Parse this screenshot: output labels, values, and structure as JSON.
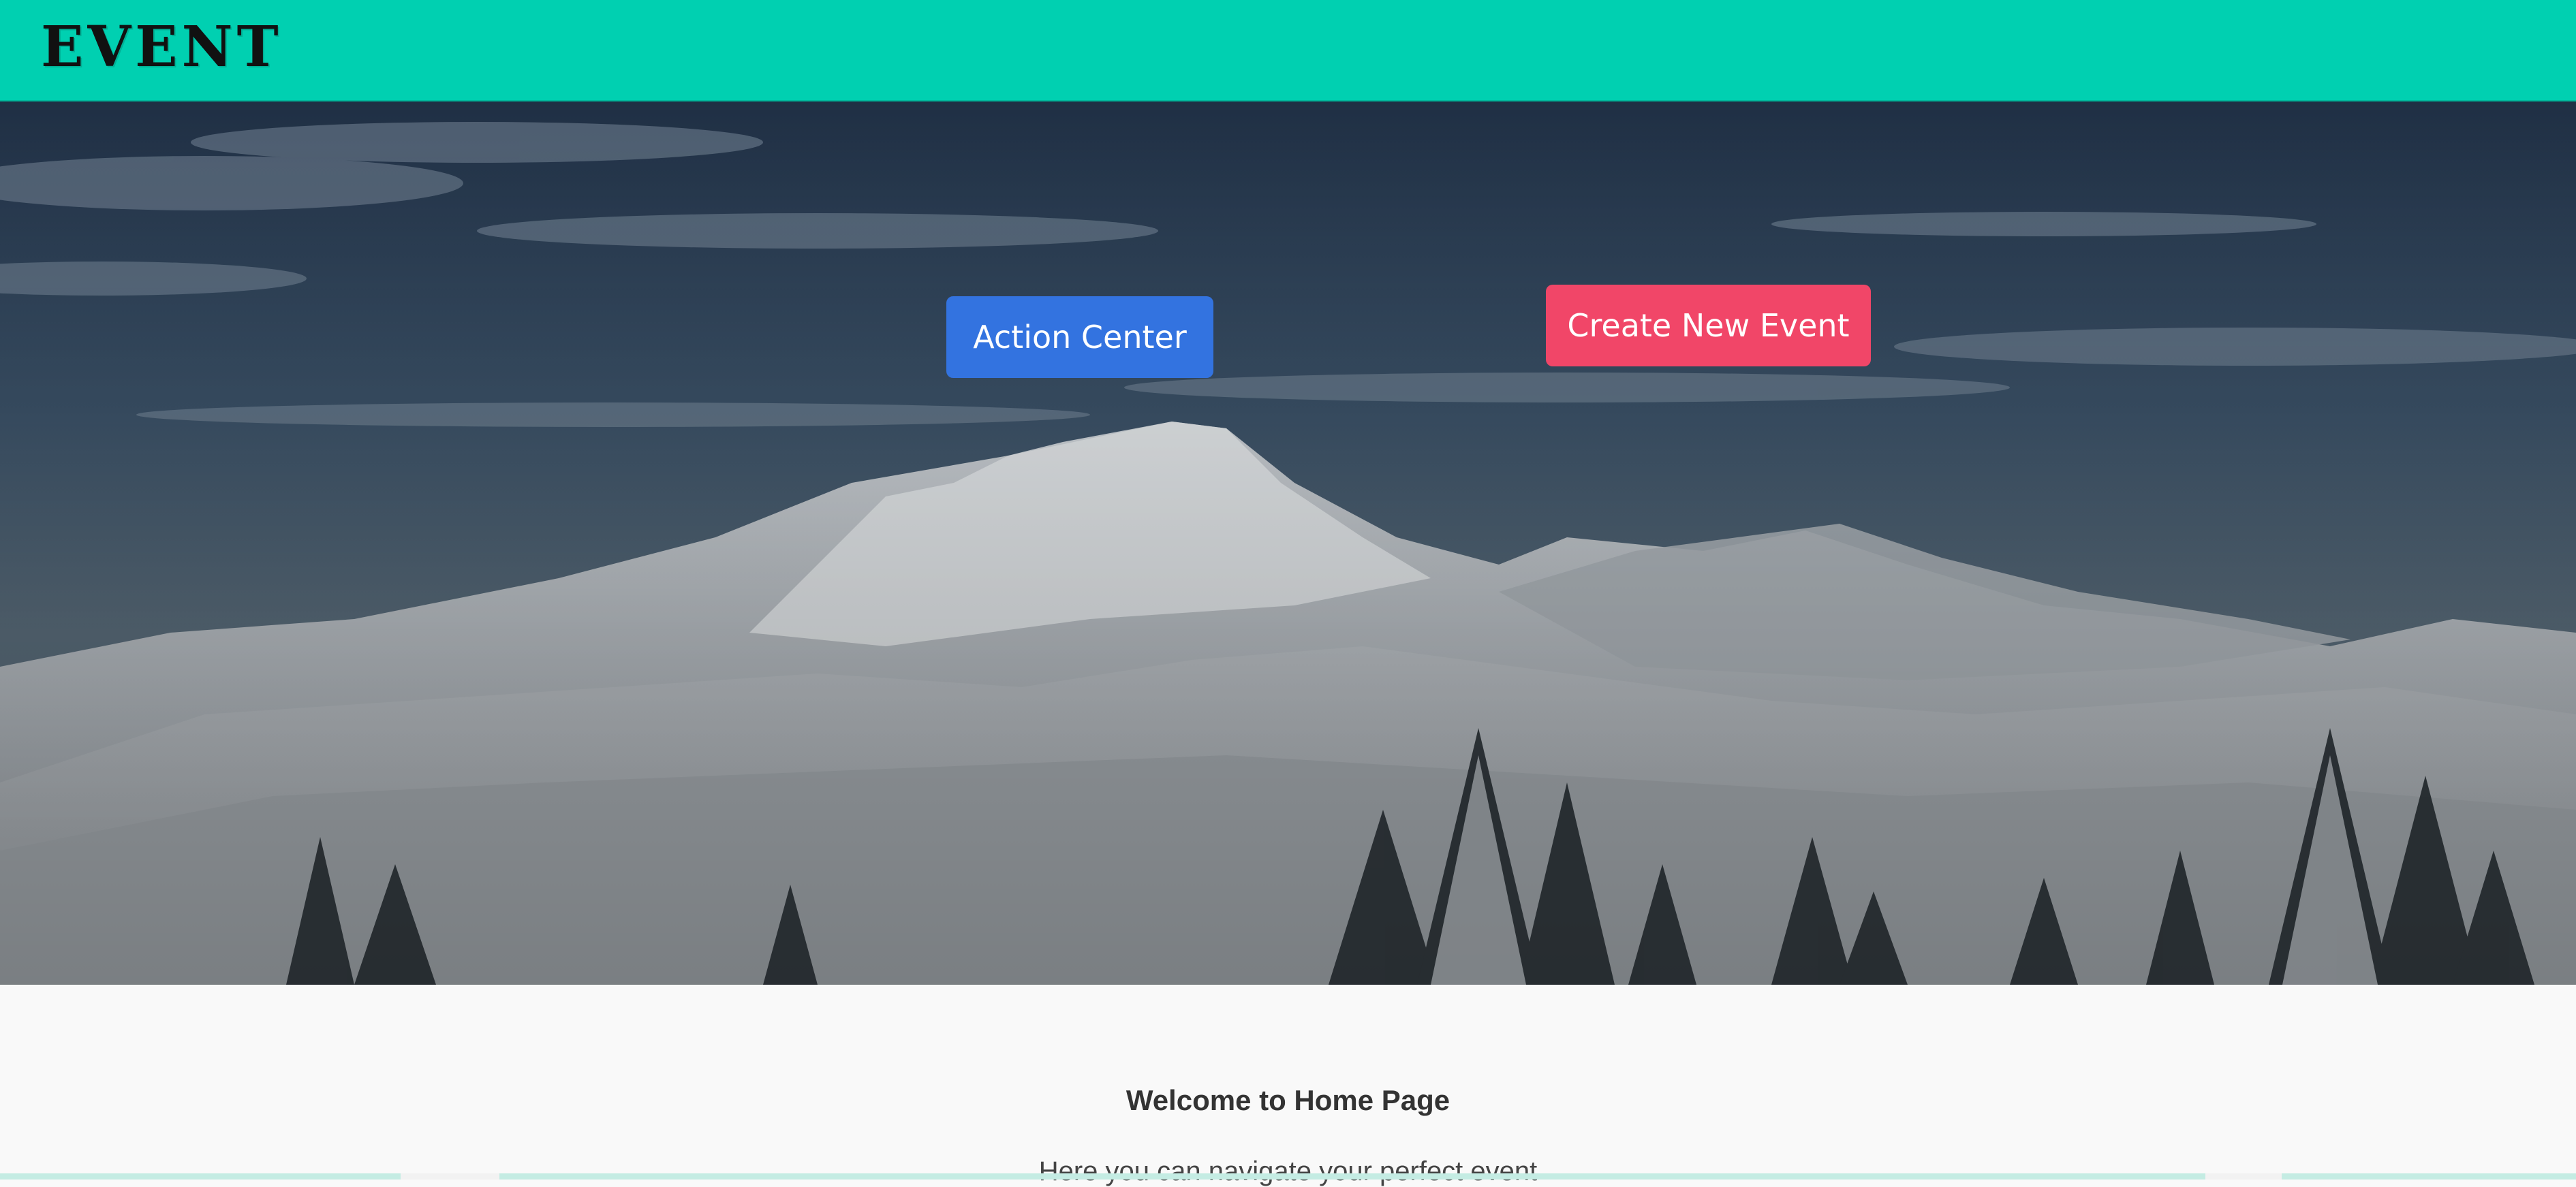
{
  "header": {
    "brand": "EVENT"
  },
  "hero": {
    "action_center_label": "Action Center",
    "create_event_label": "Create New Event"
  },
  "welcome": {
    "title": "Welcome to Home Page",
    "subtitle": "Here you can navigate your perfect event"
  },
  "colors": {
    "navbar": "#00d0b1",
    "action_button": "#3373e0",
    "create_button": "#f14668",
    "page_background": "#f9f9f9"
  }
}
